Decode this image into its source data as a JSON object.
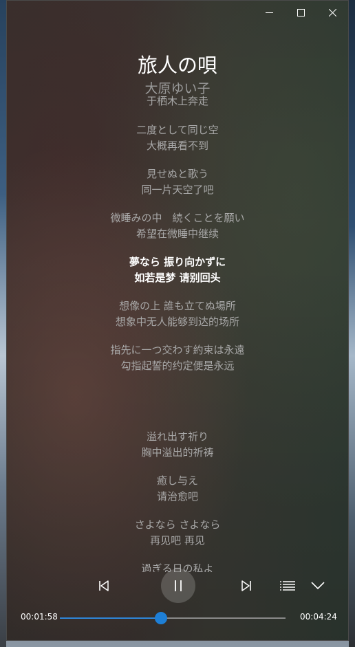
{
  "window": {
    "minimize_icon": "minimize-icon",
    "maximize_icon": "maximize-icon",
    "close_icon": "close-icon"
  },
  "song": {
    "title": "旅人の唄",
    "artist": "大原ゆい子"
  },
  "lyrics": [
    {
      "text": "于栖木上奔走",
      "kind": "translation",
      "active": false
    },
    {
      "text": "二度として同じ空",
      "kind": "original",
      "active": false
    },
    {
      "text": "大概再看不到",
      "kind": "translation",
      "active": false
    },
    {
      "text": "見せぬと歌う",
      "kind": "original",
      "active": false
    },
    {
      "text": "同一片天空了吧",
      "kind": "translation",
      "active": false
    },
    {
      "text": "微睡みの中　続くことを願い",
      "kind": "original",
      "active": false
    },
    {
      "text": "希望在微睡中继续",
      "kind": "translation",
      "active": false
    },
    {
      "text": "夢なら 振り向かずに",
      "kind": "original",
      "active": true
    },
    {
      "text": "如若是梦 请别回头",
      "kind": "translation",
      "active": true
    },
    {
      "text": "想像の上 誰も立てぬ場所",
      "kind": "original",
      "active": false
    },
    {
      "text": "想象中无人能够到达的场所",
      "kind": "translation",
      "active": false
    },
    {
      "text": "指先に一つ交わす約束は永遠",
      "kind": "original",
      "active": false
    },
    {
      "text": "勾指起誓的约定便是永远",
      "kind": "translation",
      "active": false
    },
    {
      "text": "溢れ出す祈り",
      "kind": "original",
      "active": false
    },
    {
      "text": "胸中溢出的祈祷",
      "kind": "translation",
      "active": false
    },
    {
      "text": "癒し与え",
      "kind": "original",
      "active": false
    },
    {
      "text": "请治愈吧",
      "kind": "translation",
      "active": false
    },
    {
      "text": "さよなら さよなら",
      "kind": "original",
      "active": false
    },
    {
      "text": "再见吧 再见",
      "kind": "translation",
      "active": false
    },
    {
      "text": "過ぎる日の私よ",
      "kind": "original",
      "active": false
    }
  ],
  "player": {
    "elapsed": "00:01:58",
    "duration": "00:04:24",
    "progress_fraction": 0.447,
    "accent_color": "#1e7fd6",
    "icons": [
      "previous-icon",
      "pause-icon",
      "next-icon",
      "playlist-icon",
      "collapse-chevron-icon"
    ]
  }
}
